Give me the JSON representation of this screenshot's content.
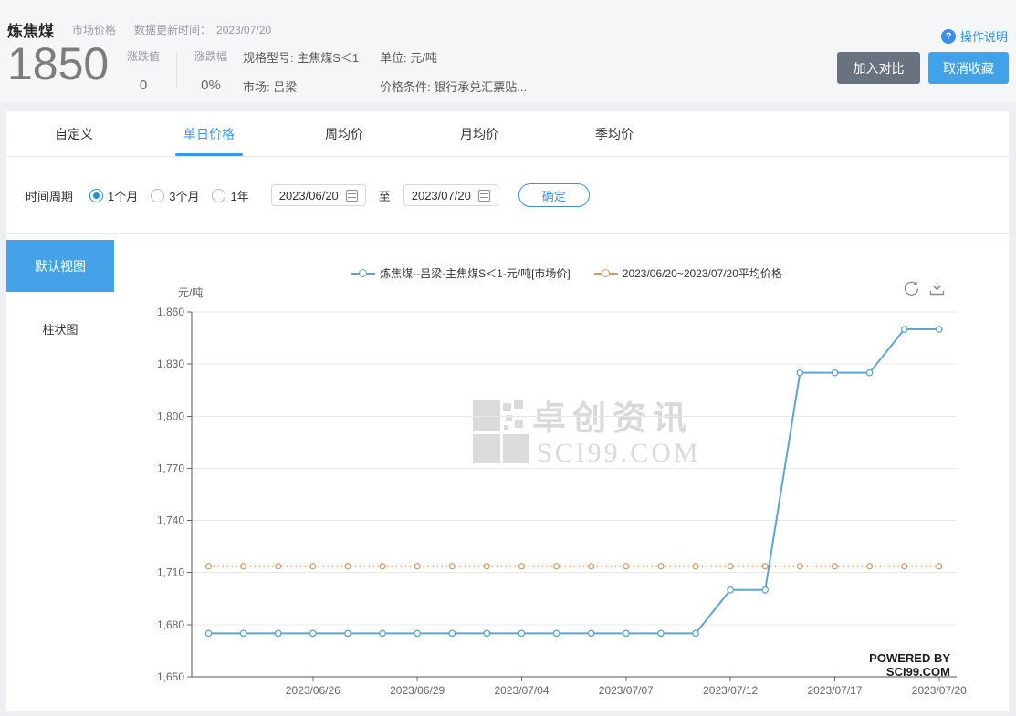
{
  "header": {
    "product_name": "炼焦煤",
    "price_type": "市场价格",
    "update_time_label": "数据更新时间：",
    "update_time": "2023/07/20",
    "price": "1850",
    "change_value_label": "涨跌值",
    "change_value": "0",
    "change_pct_label": "涨跌幅",
    "change_pct": "0%",
    "spec_label": "规格型号: 主焦煤S＜1",
    "market_label": "市场: 吕梁",
    "unit_label": "单位: 元/吨",
    "condition_label": "价格条件: 银行承兑汇票贴...",
    "help_icon": "?",
    "help_label": "操作说明",
    "compare_button": "加入对比",
    "unfavorite_button": "取消收藏"
  },
  "tabs": {
    "items": [
      {
        "label": "自定义",
        "active": false
      },
      {
        "label": "单日价格",
        "active": true
      },
      {
        "label": "周均价",
        "active": false
      },
      {
        "label": "月均价",
        "active": false
      },
      {
        "label": "季均价",
        "active": false
      }
    ]
  },
  "filter": {
    "period_label": "时间周期",
    "options": [
      {
        "label": "1个月",
        "selected": true
      },
      {
        "label": "3个月",
        "selected": false
      },
      {
        "label": "1年",
        "selected": false
      }
    ],
    "start_date": "2023/06/20",
    "to_label": "至",
    "end_date": "2023/07/20",
    "confirm_button": "确定"
  },
  "sidebar": {
    "default_view": "默认视图",
    "bar_view": "柱状图"
  },
  "chart": {
    "watermark_cn": "卓创资讯",
    "watermark_en": "SCI99.COM",
    "powered_by": "POWERED BY SCI99.COM"
  },
  "colors": {
    "accent_blue": "#3a96e8",
    "button_gray": "#6a7280",
    "button_blue": "#42a2e8",
    "line_blue": "#5fa4d4",
    "line_orange": "#e8955c"
  },
  "chart_data": {
    "type": "line",
    "ylabel": "元/吨",
    "ylim": [
      1650,
      1860
    ],
    "yticks": [
      1650,
      1680,
      1710,
      1740,
      1770,
      1800,
      1830,
      1860
    ],
    "ytick_labels": [
      "1,650",
      "1,680",
      "1,710",
      "1,740",
      "1,770",
      "1,800",
      "1,830",
      "1,860"
    ],
    "grid": true,
    "legend_position": "top",
    "x_dates": [
      "2023/06/20",
      "2023/06/21",
      "2023/06/25",
      "2023/06/26",
      "2023/06/27",
      "2023/06/28",
      "2023/06/29",
      "2023/06/30",
      "2023/07/03",
      "2023/07/04",
      "2023/07/05",
      "2023/07/06",
      "2023/07/07",
      "2023/07/10",
      "2023/07/11",
      "2023/07/12",
      "2023/07/13",
      "2023/07/14",
      "2023/07/17",
      "2023/07/18",
      "2023/07/19",
      "2023/07/20"
    ],
    "xtick_labels": [
      "2023/06/26",
      "2023/06/29",
      "2023/07/04",
      "2023/07/07",
      "2023/07/12",
      "2023/07/17",
      "2023/07/20"
    ],
    "xtick_indices": [
      3,
      6,
      9,
      12,
      15,
      18,
      21
    ],
    "series": [
      {
        "name": "炼焦煤--吕梁-主焦煤S＜1-元/吨[市场价]",
        "type": "line",
        "marker": "circle",
        "color": "#5fa4d4",
        "values": [
          1675,
          1675,
          1675,
          1675,
          1675,
          1675,
          1675,
          1675,
          1675,
          1675,
          1675,
          1675,
          1675,
          1675,
          1675,
          1700,
          1700,
          1825,
          1825,
          1825,
          1850,
          1850
        ]
      },
      {
        "name": "2023/06/20~2023/07/20平均价格",
        "type": "average-line",
        "style": "dotted",
        "marker": "circle",
        "color": "#e8955c",
        "value": 1713.64
      }
    ]
  }
}
